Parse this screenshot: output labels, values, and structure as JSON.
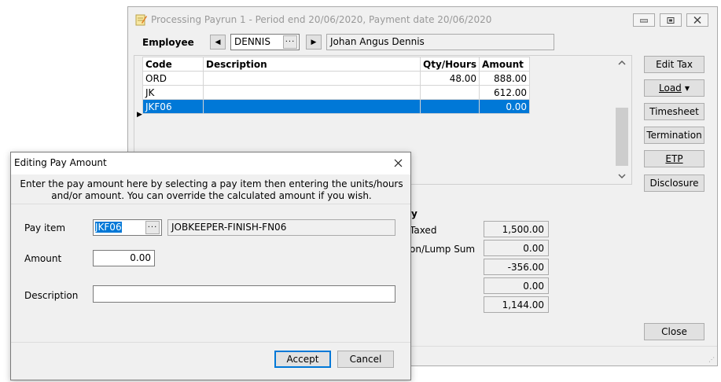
{
  "main_window": {
    "title": "Processing Payrun 1 - Period end 20/06/2020, Payment date 20/06/2020",
    "employee_label": "Employee",
    "employee_code": "DENNIS",
    "employee_name": "Johan Angus Dennis",
    "grid": {
      "headers": [
        "Code",
        "Description",
        "Qty/Hours",
        "Amount"
      ],
      "rows": [
        {
          "code": "ORD",
          "description": "",
          "qty": "48.00",
          "amount": "888.00"
        },
        {
          "code": "JK",
          "description": "",
          "qty": "",
          "amount": "612.00"
        },
        {
          "code": "JKF06",
          "description": "",
          "qty": "",
          "amount": "0.00"
        }
      ]
    },
    "side_buttons": {
      "edit_tax": "Edit Tax",
      "load": "Load",
      "timesheet": "Timesheet",
      "termination": "Termination",
      "etp": "ETP",
      "disclosure": "Disclosure"
    },
    "summary": {
      "labels": [
        "Taxed",
        "on/Lump Sum"
      ],
      "values": [
        "1,500.00",
        "0.00",
        "-356.00",
        "0.00",
        "1,144.00"
      ]
    },
    "close_button": "Close"
  },
  "dialog": {
    "title": "Editing Pay Amount",
    "instruction": "Enter the pay amount here by selecting a pay item then entering the units/hours and/or amount. You can override the calculated amount if you wish.",
    "pay_item_label": "Pay item",
    "pay_item_code": "JKF06",
    "pay_item_name": "JOBKEEPER-FINISH-FN06",
    "amount_label": "Amount",
    "amount_value": "0.00",
    "description_label": "Description",
    "description_value": "",
    "accept_button": "Accept",
    "cancel_button": "Cancel"
  },
  "colors": {
    "selection": "#0078d7",
    "window_bg": "#f0f0f0"
  }
}
